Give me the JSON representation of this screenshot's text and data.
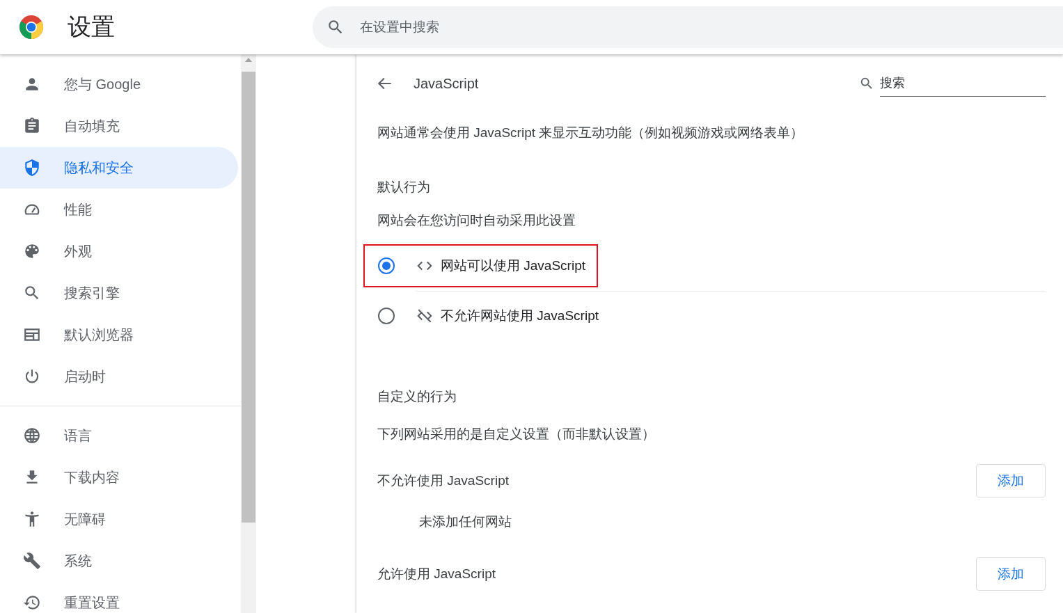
{
  "header": {
    "title": "设置",
    "search": {
      "placeholder": "在设置中搜索"
    }
  },
  "sidebar": {
    "groups": [
      {
        "items": [
          {
            "label": "您与 Google",
            "selected": false
          },
          {
            "label": "自动填充",
            "selected": false
          },
          {
            "label": "隐私和安全",
            "selected": true
          },
          {
            "label": "性能",
            "selected": false
          },
          {
            "label": "外观",
            "selected": false
          },
          {
            "label": "搜索引擎",
            "selected": false
          },
          {
            "label": "默认浏览器",
            "selected": false
          },
          {
            "label": "启动时",
            "selected": false
          }
        ]
      },
      {
        "items": [
          {
            "label": "语言",
            "selected": false
          },
          {
            "label": "下载内容",
            "selected": false
          },
          {
            "label": "无障碍",
            "selected": false
          },
          {
            "label": "系统",
            "selected": false
          },
          {
            "label": "重置设置",
            "selected": false
          }
        ]
      }
    ]
  },
  "main": {
    "title": "JavaScript",
    "search": {
      "placeholder": "搜索"
    },
    "description": "网站通常会使用 JavaScript 来显示互动功能（例如视频游戏或网络表单）",
    "default_behavior": {
      "heading": "默认行为",
      "subtitle": "网站会在您访问时自动采用此设置",
      "options": [
        {
          "label": "网站可以使用 JavaScript",
          "selected": true,
          "highlighted": true
        },
        {
          "label": "不允许网站使用 JavaScript",
          "selected": false,
          "highlighted": false
        }
      ]
    },
    "custom_behavior": {
      "heading": "自定义的行为",
      "subtitle": "下列网站采用的是自定义设置（而非默认设置）",
      "lists": [
        {
          "title": "不允许使用 JavaScript",
          "button": "添加",
          "empty": "未添加任何网站"
        },
        {
          "title": "允许使用 JavaScript",
          "button": "添加"
        }
      ]
    }
  }
}
